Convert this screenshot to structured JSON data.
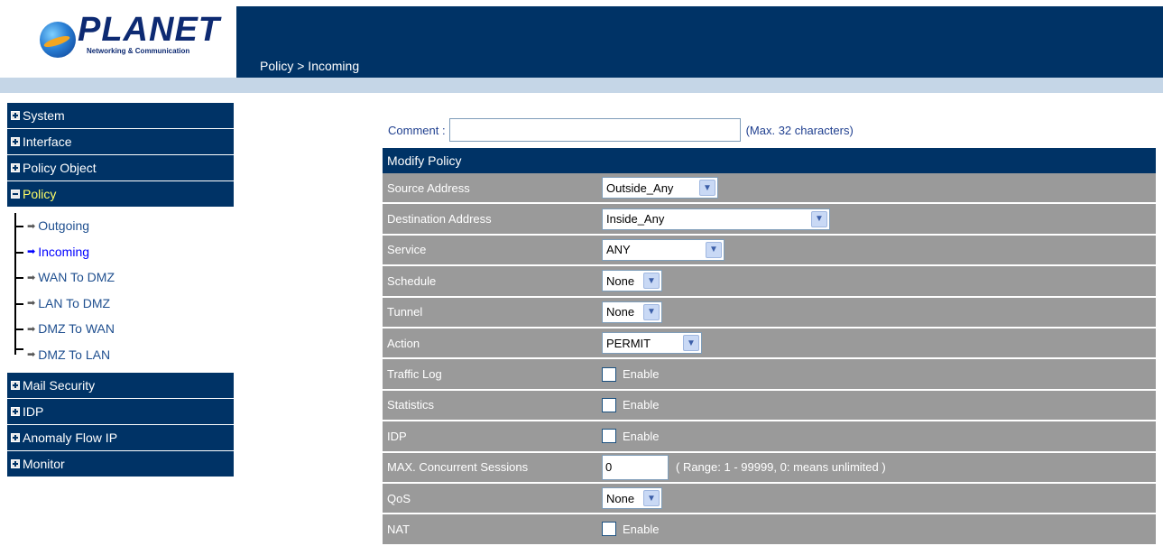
{
  "brand": {
    "name": "PLANET",
    "tagline": "Networking & Communication"
  },
  "header": {
    "breadcrumb": "Policy > Incoming"
  },
  "sidebar": {
    "items": [
      {
        "label": "System"
      },
      {
        "label": "Interface"
      },
      {
        "label": "Policy Object"
      },
      {
        "label": "Policy"
      },
      {
        "label": "Mail Security"
      },
      {
        "label": "IDP"
      },
      {
        "label": "Anomaly Flow IP"
      },
      {
        "label": "Monitor"
      }
    ],
    "policy_sub": [
      {
        "label": "Outgoing"
      },
      {
        "label": "Incoming"
      },
      {
        "label": "WAN To DMZ"
      },
      {
        "label": "LAN To DMZ"
      },
      {
        "label": "DMZ To WAN"
      },
      {
        "label": "DMZ To LAN"
      }
    ]
  },
  "form": {
    "comment_label": "Comment :",
    "comment_value": "",
    "comment_hint": "(Max. 32 characters)",
    "table_title": "Modify Policy",
    "source_address": {
      "label": "Source Address",
      "value": "Outside_Any"
    },
    "destination_address": {
      "label": "Destination Address",
      "value": "Inside_Any"
    },
    "service": {
      "label": "Service",
      "value": "ANY"
    },
    "schedule": {
      "label": "Schedule",
      "value": "None"
    },
    "tunnel": {
      "label": "Tunnel",
      "value": "None"
    },
    "action": {
      "label": "Action",
      "value": "PERMIT"
    },
    "traffic_log": {
      "label": "Traffic Log",
      "enable": "Enable"
    },
    "statistics": {
      "label": "Statistics",
      "enable": "Enable"
    },
    "idp": {
      "label": "IDP",
      "enable": "Enable"
    },
    "max_sessions": {
      "label": "MAX. Concurrent Sessions",
      "value": "0",
      "hint": "( Range: 1 - 99999, 0: means unlimited )"
    },
    "qos": {
      "label": "QoS",
      "value": "None"
    },
    "nat": {
      "label": "NAT",
      "enable": "Enable"
    }
  },
  "colors": {
    "nav": "#003366",
    "row": "#9a9a9a",
    "lightbar": "#c5d6e7",
    "active_menu": "#ffff66",
    "current_link": "#0000ff"
  }
}
